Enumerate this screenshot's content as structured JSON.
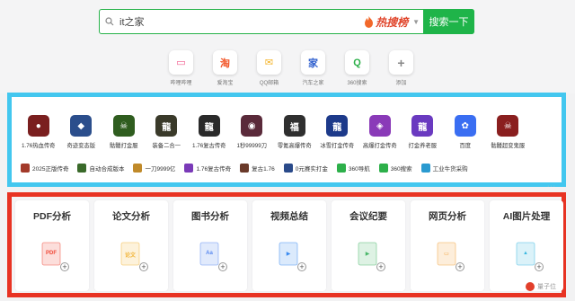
{
  "search": {
    "value": "it之家",
    "hot_label": "热搜榜",
    "button_label": "搜索一下"
  },
  "quick_links": [
    {
      "label": "哔哩哔哩",
      "icon": "bilibili-icon",
      "color": "#f25d8e",
      "glyph": "▭"
    },
    {
      "label": "爱淘宝",
      "icon": "taobao-icon",
      "color": "#f2572a",
      "glyph": "淘"
    },
    {
      "label": "QQ邮箱",
      "icon": "qq-mail-icon",
      "color": "#f4b327",
      "glyph": "✉"
    },
    {
      "label": "汽车之家",
      "icon": "autohome-icon",
      "color": "#2c5dcd",
      "glyph": "家"
    },
    {
      "label": "360搜索",
      "icon": "360-search-icon",
      "color": "#2db04a",
      "glyph": "Q"
    },
    {
      "label": "添加",
      "icon": "add-icon",
      "color": "#888888",
      "glyph": "+"
    }
  ],
  "games": [
    {
      "label": "1.76热血传奇",
      "color": "#7a1f1f",
      "glyph": "●"
    },
    {
      "label": "奇迹变态版",
      "color": "#2b4e8c",
      "glyph": "◆"
    },
    {
      "label": "骷髅打金服",
      "color": "#2f5d1f",
      "glyph": "☠"
    },
    {
      "label": "装备二合一",
      "color": "#3a3a2a",
      "glyph": "龍"
    },
    {
      "label": "1.76复古传奇",
      "color": "#2a2a2a",
      "glyph": "龍"
    },
    {
      "label": "1秒99999刀",
      "color": "#5a2a3a",
      "glyph": "◉"
    },
    {
      "label": "零氪高爆传奇",
      "color": "#2f2f2f",
      "glyph": "福"
    },
    {
      "label": "冰雪打金传奇",
      "color": "#1d3a8a",
      "glyph": "龍"
    },
    {
      "label": "高爆打金传奇",
      "color": "#8a3ab8",
      "glyph": "◈"
    },
    {
      "label": "打金养老服",
      "color": "#6a3ac0",
      "glyph": "龍"
    },
    {
      "label": "百度",
      "color": "#3a6ef2",
      "glyph": "✿"
    },
    {
      "label": "骷髅超变鬼服",
      "color": "#8a1f1f",
      "glyph": "☠"
    }
  ],
  "text_links": [
    {
      "label": "2025正版传奇",
      "color": "#a33a2a"
    },
    {
      "label": "自动合成版本",
      "color": "#3a6a2a"
    },
    {
      "label": "一刀9999亿",
      "color": "#c08a2a"
    },
    {
      "label": "1.76复古传奇",
      "color": "#7a3ab8"
    },
    {
      "label": "复古1.76",
      "color": "#6a3a2a"
    },
    {
      "label": "0元赛实打金",
      "color": "#2a4a8a"
    },
    {
      "label": "360导航",
      "color": "#2db04a"
    },
    {
      "label": "360搜索",
      "color": "#2db04a"
    },
    {
      "label": "工业牛货采购",
      "color": "#2a9ad0"
    }
  ],
  "tools": [
    {
      "label": "PDF分析",
      "icon": "pdf-icon",
      "color": "#f04a3a",
      "glyph": "PDF"
    },
    {
      "label": "论文分析",
      "icon": "paper-icon",
      "color": "#f2b53a",
      "glyph": "论文"
    },
    {
      "label": "图书分析",
      "icon": "book-icon",
      "color": "#5a8af0",
      "glyph": "Aa"
    },
    {
      "label": "视频总结",
      "icon": "video-icon",
      "color": "#3a8af0",
      "glyph": "▶"
    },
    {
      "label": "会议纪要",
      "icon": "meeting-icon",
      "color": "#4ab86a",
      "glyph": "▶"
    },
    {
      "label": "网页分析",
      "icon": "webpage-icon",
      "color": "#f2a23a",
      "glyph": "▭"
    },
    {
      "label": "AI图片处理",
      "icon": "image-icon",
      "color": "#3ab8e0",
      "glyph": "▲"
    }
  ],
  "watermark": "量子位"
}
